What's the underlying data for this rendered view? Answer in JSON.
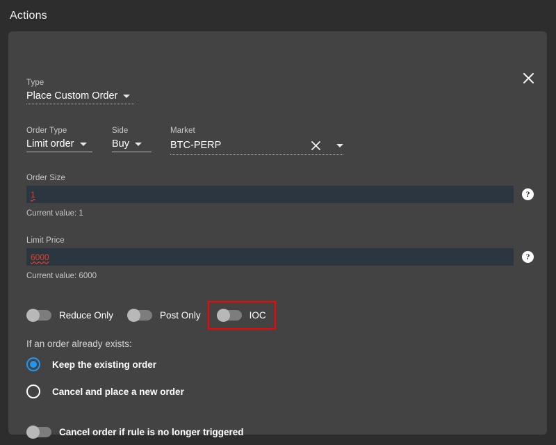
{
  "header": {
    "title": "Actions"
  },
  "panel": {
    "close_icon": "close-icon"
  },
  "type_field": {
    "label": "Type",
    "value": "Place Custom Order"
  },
  "order_type_field": {
    "label": "Order Type",
    "value": "Limit order"
  },
  "side_field": {
    "label": "Side",
    "value": "Buy"
  },
  "market_field": {
    "label": "Market",
    "value": "BTC-PERP",
    "clear_icon": "close-icon",
    "dropdown_icon": "chevron-down-icon"
  },
  "order_size": {
    "label": "Order Size",
    "value": "1",
    "current_value": "Current value: 1",
    "help_icon": "?"
  },
  "limit_price": {
    "label": "Limit Price",
    "value": "6000",
    "current_value": "Current value: 6000",
    "help_icon": "?"
  },
  "toggles": {
    "reduce_only": {
      "label": "Reduce Only",
      "state": "off"
    },
    "post_only": {
      "label": "Post Only",
      "state": "off"
    },
    "ioc": {
      "label": "IOC",
      "state": "off",
      "highlight_color": "#ff0000"
    }
  },
  "order_exists": {
    "label": "If an order already exists:",
    "options": [
      {
        "label": "Keep the existing order",
        "selected": true
      },
      {
        "label": "Cancel and place a new order",
        "selected": false
      }
    ]
  },
  "cancel_rule": {
    "label": "Cancel order if rule is no longer triggered",
    "state": "off"
  },
  "colors": {
    "page_background": "#2d2d2d",
    "panel_background": "#434343",
    "input_background": "#2b3640",
    "input_text": "#e8402a",
    "accent_radio": "#2196f3",
    "highlight_border": "#ff0000"
  }
}
